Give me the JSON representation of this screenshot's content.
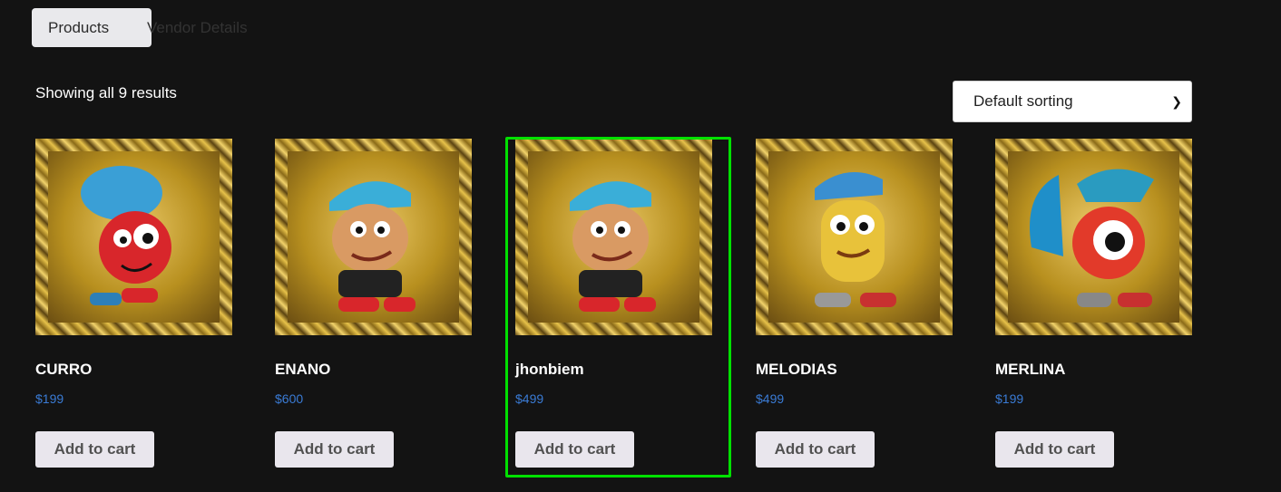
{
  "tabs": [
    {
      "label": "Products",
      "active": true
    },
    {
      "label": "Vendor Details",
      "active": false
    }
  ],
  "result_count": "Showing all 9 results",
  "sorting": {
    "selected": "Default sorting"
  },
  "products": [
    {
      "name": "CURRO",
      "price": "$199",
      "button": "Add to cart",
      "image": "cartoon-character-image"
    },
    {
      "name": "ENANO",
      "price": "$600",
      "button": "Add to cart",
      "image": "cartoon-character-image"
    },
    {
      "name": "jhonbiem",
      "price": "$499",
      "button": "Add to cart",
      "image": "cartoon-character-image",
      "highlighted": true
    },
    {
      "name": "MELODIAS",
      "price": "$499",
      "button": "Add to cart",
      "image": "cartoon-character-image"
    },
    {
      "name": "MERLINA",
      "price": "$199",
      "button": "Add to cart",
      "image": "cartoon-character-image"
    }
  ],
  "colors": {
    "background": "#131313",
    "price": "#3a7bd5",
    "highlight": "#00e000",
    "button_bg": "#e9e6ed"
  }
}
